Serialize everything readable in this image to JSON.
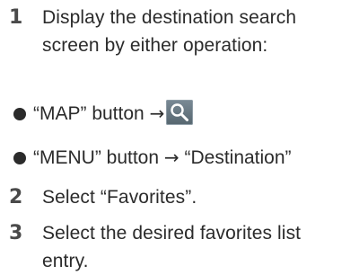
{
  "steps": [
    {
      "number": "1",
      "text": "Display the destination search screen by either operation:"
    },
    {
      "number": "2",
      "text": "Select “Favorites”."
    },
    {
      "number": "3",
      "text": "Select the desired favorites list entry."
    }
  ],
  "bullets": [
    {
      "text_before": "“MAP” button ",
      "arrow": "→",
      "icon": "search-icon"
    },
    {
      "text_before": "“MENU” button ",
      "arrow": "→",
      "text_after": " “Destination”"
    }
  ],
  "colors": {
    "text": "#2b2b2b",
    "step_number": "#4a4a4a",
    "search_button_top": "#7a8a96",
    "search_button_bottom": "#56666f"
  }
}
